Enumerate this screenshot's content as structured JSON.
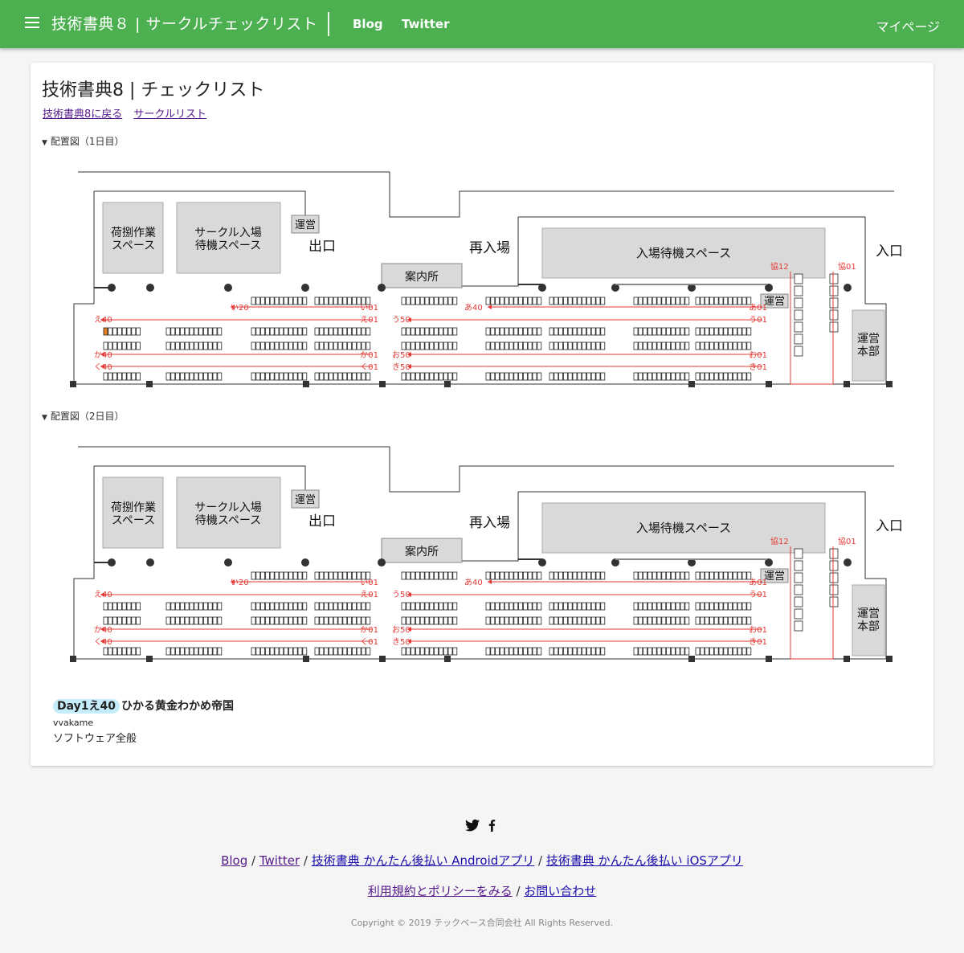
{
  "header": {
    "title": "技術書典８ | サークルチェックリスト",
    "nav": [
      "Blog",
      "Twitter"
    ],
    "mypage": "マイページ"
  },
  "card": {
    "title": "技術書典8 | チェックリスト",
    "links": [
      "技術書典8に戻る",
      "サークルリスト"
    ],
    "maps": [
      {
        "summary": "配置図（1日目）"
      },
      {
        "summary": "配置図（2日目）"
      }
    ]
  },
  "venue": {
    "labels": {
      "packing": [
        "荷捌作業",
        "スペース"
      ],
      "circle_wait": [
        "サークル入場",
        "待機スペース"
      ],
      "staff": "運営",
      "exit": "出口",
      "reentry": "再入場",
      "info": "案内所",
      "entry_wait": "入場待機スペース",
      "entrance": "入口",
      "hq": [
        "運営",
        "本部"
      ]
    },
    "row_labels": {
      "i20": "い20",
      "i01": "い01",
      "e40": "え40",
      "e01": "え01",
      "ka40": "か40",
      "ka01": "か01",
      "ku40": "く40",
      "ku01": "く01",
      "a40": "あ40",
      "a01": "あ01",
      "u50": "う50",
      "u01": "う01",
      "o50": "お50",
      "o01": "お01",
      "ki50": "き50",
      "ki01": "き01",
      "kyo12": "協12",
      "kyo01": "協01"
    },
    "highlight_day1": "え40",
    "colors": {
      "arrow": "#e53935",
      "highlight": "#e67e22",
      "staff_box": "#d9d9d9"
    }
  },
  "circle": {
    "badge": "Day1え40",
    "name": "ひかる黄金わかめ帝国",
    "author": "vvakame",
    "genre": "ソフトウェア全般"
  },
  "footer": {
    "links1": [
      "Blog",
      "Twitter",
      "技術書典 かんたん後払い Androidアプリ",
      "技術書典 かんたん後払い iOSアプリ"
    ],
    "links2": [
      "利用規約とポリシーをみる",
      "お問い合わせ"
    ],
    "copyright": "Copyright © 2019 テックベース合同会社 All Rights Reserved."
  }
}
